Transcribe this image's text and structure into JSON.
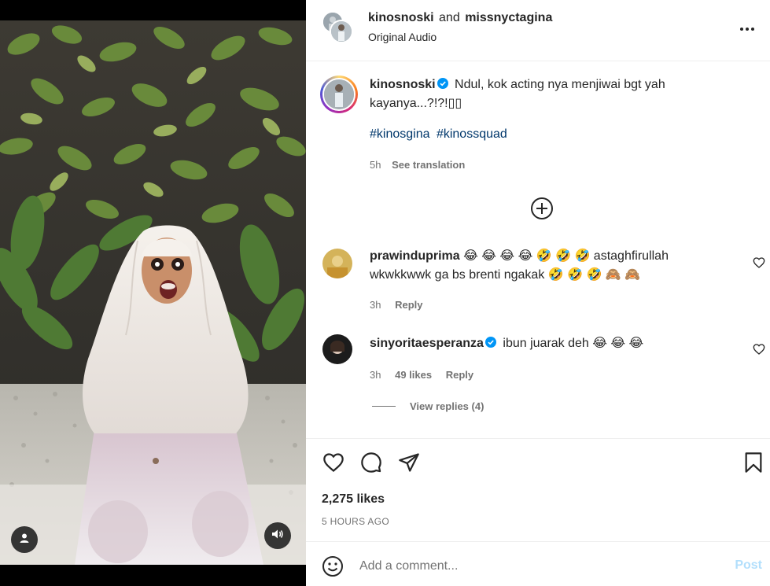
{
  "post": {
    "author1": "kinosnoski",
    "author_join": "and",
    "author2": "missnyctagina",
    "audio_label": "Original Audio"
  },
  "caption": {
    "username": "kinosnoski",
    "text": "Ndul, kok acting nya menjiwai bgt yah kayanya...?!?!▯▯",
    "hashtags": [
      "#kinosgina",
      "#kinossquad"
    ],
    "time": "5h",
    "translate_label": "See translation"
  },
  "comments": [
    {
      "username": "prawinduprima",
      "text": "😂 😂 😂 😂 🤣 🤣 🤣 astaghfirullah wkwkkwwk ga bs brenti ngakak 🤣 🤣 🤣 🙈 🙈",
      "time": "3h",
      "reply_label": "Reply",
      "verified": false
    },
    {
      "username": "sinyoritaesperanza",
      "text": "ibun juarak deh 😂 😂 😂",
      "time": "3h",
      "likes_label": "49 likes",
      "reply_label": "Reply",
      "verified": true,
      "view_replies_label": "View replies (4)"
    }
  ],
  "actions": {
    "likes_label": "2,275 likes",
    "timestamp": "5 HOURS AGO"
  },
  "composer": {
    "placeholder": "Add a comment...",
    "post_label": "Post"
  },
  "icons": {
    "verified": "verified-badge-icon",
    "more": "more-horizontal-icon",
    "load_more": "plus-circle-icon",
    "like": "heart-icon",
    "comment": "comment-bubble-icon",
    "share": "paper-plane-icon",
    "save": "bookmark-icon",
    "emoji": "emoji-face-icon",
    "tag": "user-tag-icon",
    "sound": "speaker-icon"
  },
  "colors": {
    "link": "#00376b",
    "verified": "#0095f6",
    "post_disabled": "#b2dffc",
    "muted": "#737373"
  }
}
